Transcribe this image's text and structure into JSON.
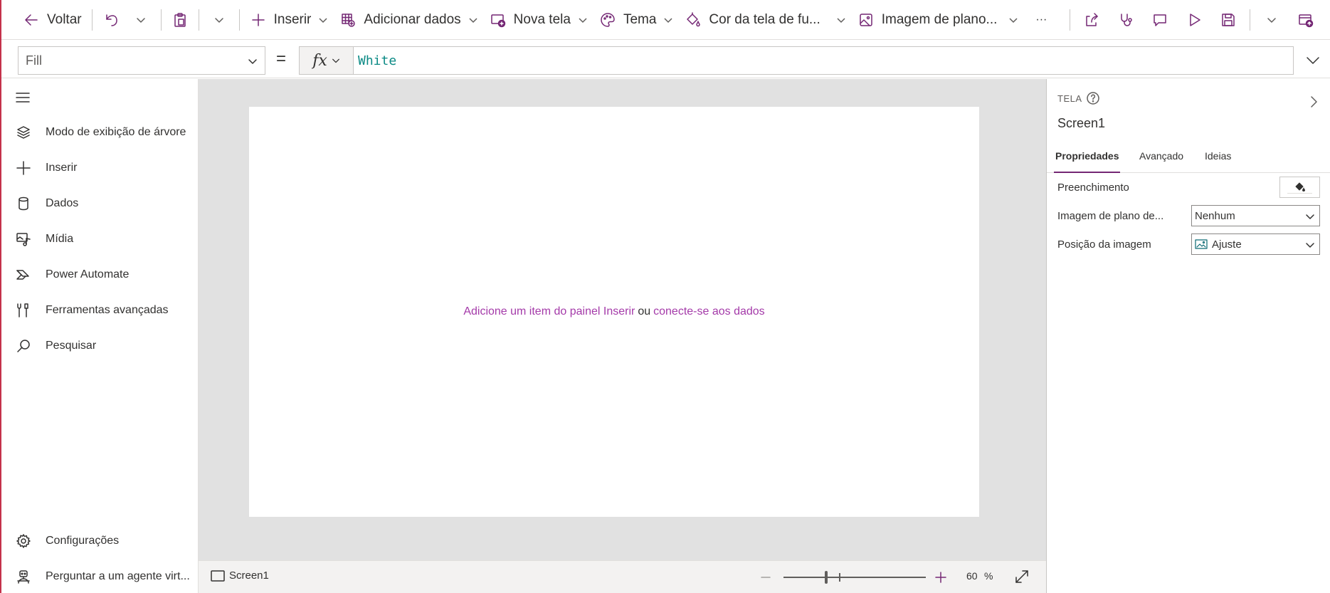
{
  "toolbar": {
    "back_label": "Voltar",
    "insert_label": "Inserir",
    "add_data_label": "Adicionar dados",
    "new_screen_label": "Nova tela",
    "theme_label": "Tema",
    "background_color_label": "Cor da tela de fu...",
    "background_image_label": "Imagem de plano...",
    "more_label": "···"
  },
  "formula_bar": {
    "property": "Fill",
    "equals": "=",
    "fx_label": "fx",
    "formula": "White"
  },
  "left_nav": {
    "items": [
      {
        "label": "Modo de exibição de árvore",
        "icon": "layers-icon"
      },
      {
        "label": "Inserir",
        "icon": "plus-icon"
      },
      {
        "label": "Dados",
        "icon": "database-icon"
      },
      {
        "label": "Mídia",
        "icon": "media-icon"
      },
      {
        "label": "Power Automate",
        "icon": "power-automate-icon"
      },
      {
        "label": "Ferramentas avançadas",
        "icon": "tools-icon"
      },
      {
        "label": "Pesquisar",
        "icon": "search-icon"
      }
    ],
    "bottom_items": [
      {
        "label": "Configurações",
        "icon": "gear-icon"
      },
      {
        "label": "Perguntar a um agente virt...",
        "icon": "agent-icon"
      }
    ]
  },
  "canvas": {
    "empty_link_insert": "Adicione um item do painel Inserir",
    "empty_middle": "ou",
    "empty_link_data": "conecte-se aos dados",
    "background_color": "#ffffff"
  },
  "status_bar": {
    "screen_name": "Screen1",
    "zoom_value": "60",
    "zoom_unit": "%",
    "zoom_fraction": 0.3
  },
  "properties_pane": {
    "type_label": "TELA",
    "screen_name": "Screen1",
    "tabs": [
      "Propriedades",
      "Avançado",
      "Ideias"
    ],
    "active_tab": "Propriedades",
    "rows": {
      "fill_label": "Preenchimento",
      "background_image_label": "Imagem de plano de...",
      "background_image_value": "Nenhum",
      "image_position_label": "Posição da imagem",
      "image_position_value": "Ajuste"
    }
  },
  "colors": {
    "accent": "#742774",
    "link": "#a43aa9",
    "formula_text": "#0b8a85",
    "left_accent_line": "#c4314b"
  }
}
